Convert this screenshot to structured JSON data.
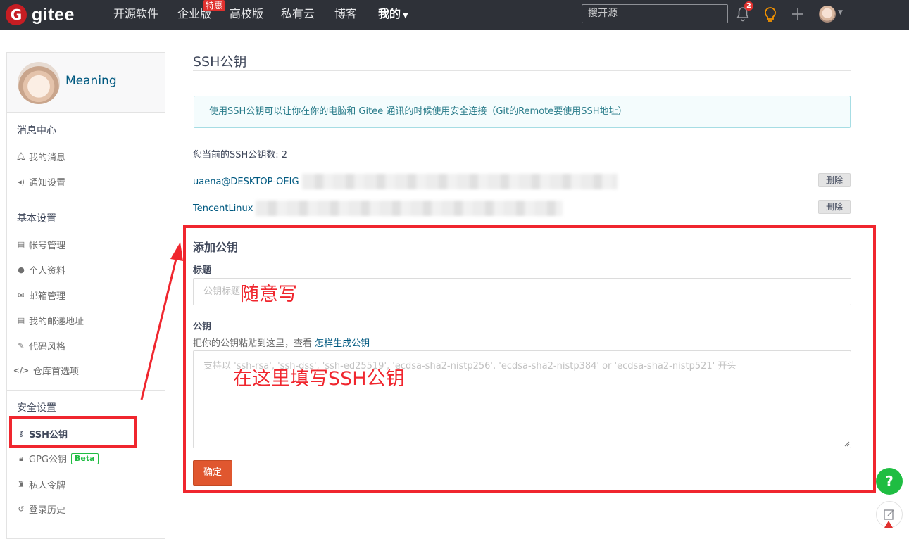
{
  "nav": {
    "logo_text": "gitee",
    "items": [
      "开源软件",
      "企业版",
      "高校版",
      "私有云",
      "博客",
      "我的"
    ],
    "tejia_badge": "特惠",
    "search_placeholder": "搜开源",
    "notification_count": "2"
  },
  "sidebar": {
    "user_name": "Meaning",
    "group_messages": "消息中心",
    "my_messages": "我的消息",
    "notify_settings": "通知设置",
    "group_basic": "基本设置",
    "account": "帐号管理",
    "profile": "个人资料",
    "email": "邮箱管理",
    "address": "我的邮递地址",
    "code_style": "代码风格",
    "repo_pref": "仓库首选项",
    "group_security": "安全设置",
    "ssh_keys": "SSH公钥",
    "gpg_keys": "GPG公钥",
    "beta": "Beta",
    "tokens": "私人令牌",
    "login_history": "登录历史"
  },
  "main": {
    "title": "SSH公钥",
    "info": "使用SSH公钥可以让你在你的电脑和 Gitee 通讯的时候使用安全连接（Git的Remote要使用SSH地址）",
    "count_text": "您当前的SSH公钥数: 2",
    "keys": [
      {
        "name": "uaena@DESKTOP-OEIG",
        "delete_label": "删除"
      },
      {
        "name": "TencentLinux",
        "delete_label": "删除"
      }
    ],
    "add_title": "添加公钥",
    "title_label": "标题",
    "title_placeholder": "公钥标题",
    "key_label": "公钥",
    "key_hint": "把你的公钥粘贴到这里，查看",
    "key_hint_link": "怎样生成公钥",
    "key_placeholder": "支持以 'ssh-rsa', 'ssh-dss', 'ssh-ed25519', 'ecdsa-sha2-nistp256', 'ecdsa-sha2-nistp384' or 'ecdsa-sha2-nistp521' 开头",
    "submit_label": "确定"
  },
  "annotations": {
    "title_note": "随意写",
    "key_note": "在这里填写SSH公钥",
    "color": "#f0262e"
  },
  "float": {
    "help_label": "?"
  }
}
